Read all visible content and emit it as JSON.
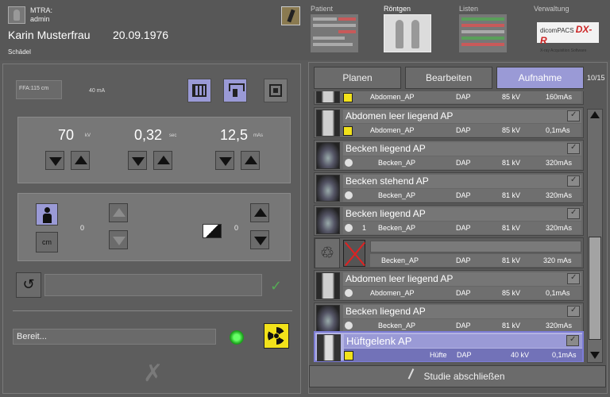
{
  "header": {
    "user_role": "MTRA:",
    "user_name": "admin",
    "patient_name": "Karin Musterfrau",
    "patient_dob": "20.09.1976",
    "exam": "Schädel"
  },
  "nav_tabs": [
    {
      "label": "Patient"
    },
    {
      "label": "Röntgen"
    },
    {
      "label": "Listen"
    },
    {
      "label": "Verwaltung"
    }
  ],
  "logo": {
    "brand": "dicomPACS",
    "suffix": "DX-R",
    "tagline": "X-ray Acquisition Software"
  },
  "exposure": {
    "ffa": "FFA:115 cm",
    "ma": "40 mA",
    "kv_value": "70",
    "kv_unit": "kV",
    "sec_value": "0,32",
    "sec_unit": "sec",
    "mas_value": "12,5",
    "mas_unit": "mAs",
    "thickness_value": "0",
    "thickness_unit": "cm",
    "density_value": "0"
  },
  "status": {
    "text": "Bereit..."
  },
  "tabs": [
    {
      "label": "Planen"
    },
    {
      "label": "Bearbeiten"
    },
    {
      "label": "Aufnahme"
    }
  ],
  "counter": "10/15",
  "exams": [
    {
      "title": "",
      "param_name": "Abdomen_AP",
      "dose": "DAP",
      "kv": "85 kV",
      "mas": "160mAs"
    },
    {
      "title": "Abdomen leer liegend AP",
      "param_name": "Abdomen_AP",
      "dose": "DAP",
      "kv": "85 kV",
      "mas": "0,1mAs"
    },
    {
      "title": "Becken liegend AP",
      "param_name": "Becken_AP",
      "dose": "DAP",
      "kv": "81 kV",
      "mas": "320mAs"
    },
    {
      "title": "Becken stehend AP",
      "param_name": "Becken_AP",
      "dose": "DAP",
      "kv": "81 kV",
      "mas": "320mAs"
    },
    {
      "title": "Becken liegend AP",
      "param_name": "Becken_AP",
      "dose": "DAP",
      "kv": "81 kV",
      "mas": "320mAs",
      "count": "1"
    },
    {
      "title": "",
      "param_name": "Becken_AP",
      "dose": "DAP",
      "kv": "81 kV",
      "mas": "320 mAs",
      "rejected": true
    },
    {
      "title": "Abdomen leer liegend AP",
      "param_name": "Abdomen_AP",
      "dose": "DAP",
      "kv": "85 kV",
      "mas": "0,1mAs"
    },
    {
      "title": "Becken liegend AP",
      "param_name": "Becken_AP",
      "dose": "DAP",
      "kv": "81 kV",
      "mas": "320mAs"
    },
    {
      "title": "Hüftgelenk AP",
      "param_name": "Hüfte",
      "dose": "DAP",
      "kv": "40 kV",
      "mas": "0,1mAs",
      "selected": true
    }
  ],
  "finish_button": "Studie abschließen"
}
